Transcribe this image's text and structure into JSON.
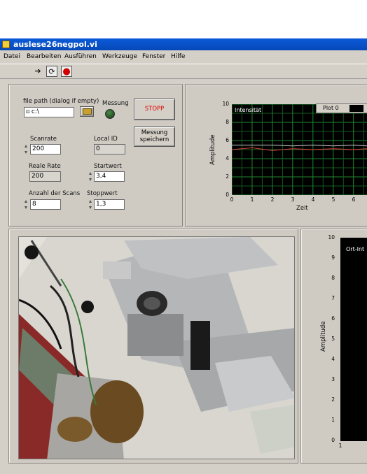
{
  "window": {
    "title": "auslese26negpol.vi"
  },
  "menu": [
    "Datei",
    "Bearbeiten",
    "Ausführen",
    "Werkzeuge",
    "Fenster",
    "Hilfe"
  ],
  "toolbar": [
    {
      "name": "run-arrow-icon",
      "glyph": "➔"
    },
    {
      "name": "run-continuously-icon",
      "glyph": "⟳"
    },
    {
      "name": "abort-icon",
      "glyph": "●"
    }
  ],
  "controls": {
    "file_path_label": "file path (dialog if empty)",
    "file_path_value": "c:\\",
    "messung_label": "Messung",
    "stopp_label": "STOPP",
    "speichern_label": "Messung speichern",
    "scanrate_label": "Scanrate",
    "scanrate_value": "200",
    "local_id_label": "Local ID",
    "local_id_value": "0",
    "reale_rate_label": "Reale Rate",
    "reale_rate_value": "200",
    "startwert_label": "Startwert",
    "startwert_value": "3,4",
    "anzahl_label": "Anzahl der Scans",
    "anzahl_value": "8",
    "stoppwert_label": "Stoppwert",
    "stoppwert_value": "1,3"
  },
  "graph1": {
    "ylabel": "Amplitude",
    "xlabel": "Zeit",
    "inner_label": "Intensität",
    "legend_label": "Plot 0",
    "yticks": [
      "10",
      "8",
      "6",
      "4",
      "2",
      "0"
    ],
    "xticks": [
      "0",
      "1",
      "2",
      "3",
      "4",
      "5",
      "6"
    ]
  },
  "graph2": {
    "ylabel": "Amplitude",
    "inner_label": "Ort-Int",
    "yticks": [
      "10",
      "9",
      "8",
      "7",
      "6",
      "5",
      "4",
      "3",
      "2",
      "1",
      "0"
    ],
    "xticks": [
      "1"
    ]
  },
  "chart_data": {
    "type": "line",
    "x": [
      0,
      1,
      2,
      3,
      4,
      5,
      6,
      6.7
    ],
    "series": [
      {
        "values": [
          5.5,
          5.5,
          5.5,
          5.4,
          5.5,
          5.4,
          5.5,
          5.4
        ],
        "color": "#d0d0d0"
      },
      {
        "values": [
          5.0,
          5.2,
          4.9,
          5.1,
          5.0,
          5.1,
          5.0,
          5.1
        ],
        "color": "#e04040"
      }
    ],
    "ylim": [
      0,
      10
    ],
    "xlim": [
      0,
      6.7
    ],
    "grid": true,
    "title": "",
    "xlabel": "Zeit",
    "ylabel": "Amplitude"
  }
}
